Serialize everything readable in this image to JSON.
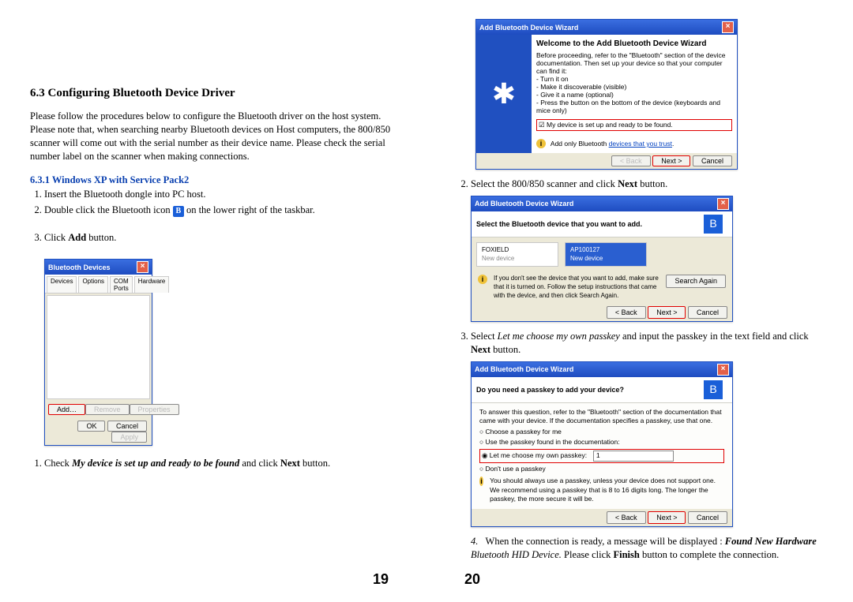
{
  "left": {
    "section_number": "6.3",
    "section_title": "Configuring Bluetooth Device Driver",
    "intro": "Please follow the procedures below to configure the Bluetooth driver on the host system. Please note that, when searching nearby Bluetooth devices on Host computers, the 800/850 scanner will come out with the serial number as their device name. Please check the serial number label on the scanner when making connections.",
    "sub_number": "6.3.1",
    "sub_title": "Windows XP with Service Pack2",
    "step1": "Insert the Bluetooth dongle into PC host.",
    "step2_pre": "Double click the Bluetooth icon",
    "step2_post": " on the lower right of the taskbar.",
    "step3_pre": "Click ",
    "step3_bold": "Add",
    "step3_post": " button.",
    "bottom_step_pre": "Check ",
    "bottom_step_bolditalic": "My device is set up and ready to be found",
    "bottom_step_mid": " and click ",
    "bottom_step_bold": "Next",
    "bottom_step_post": " button.",
    "dlg1": {
      "title": "Bluetooth Devices",
      "tabs": {
        "a": "Devices",
        "b": "Options",
        "c": "COM Ports",
        "d": "Hardware"
      },
      "add": "Add…",
      "remove": "Remove",
      "properties": "Properties",
      "ok": "OK",
      "cancel": "Cancel",
      "apply": "Apply"
    },
    "page_num": "19"
  },
  "right": {
    "dlg_welcome": {
      "title": "Add Bluetooth Device Wizard",
      "heading": "Welcome to the Add Bluetooth Device Wizard",
      "body1": "Before proceeding, refer to the \"Bluetooth\" section of the device documentation. Then set up your device so that your computer can find it:",
      "li1": "- Turn it on",
      "li2": "- Make it discoverable (visible)",
      "li3": "- Give it a name (optional)",
      "li4": "- Press the button on the bottom of the device (keyboards and mice only)",
      "check": "My device is set up and ready to be found.",
      "hint_pre": "Add only Bluetooth ",
      "hint_link": "devices that you trust",
      "back": "< Back",
      "next": "Next >",
      "cancel": "Cancel"
    },
    "step2_pre": "Select the 800/850 scanner and click ",
    "step2_bold": "Next",
    "step2_post": " button.",
    "dlg_select": {
      "title": "Add Bluetooth Device Wizard",
      "subtitle": "Select the Bluetooth device that you want to add.",
      "dev1_name": "FOXIELD",
      "dev1_type": "New device",
      "dev2_name": "AP100127",
      "dev2_type": "New device",
      "tip": "If you don't see the device that you want to add, make sure that it is turned on. Follow the setup instructions that came with the device, and then click Search Again.",
      "search": "Search Again",
      "back": "< Back",
      "next": "Next >",
      "cancel": "Cancel"
    },
    "step3_pre": "Select ",
    "step3_italic": "Let me choose my own passkey",
    "step3_mid": " and input the passkey in the text field and click ",
    "step3_bold": "Next",
    "step3_post": " button.",
    "dlg_passkey": {
      "title": "Add Bluetooth Device Wizard",
      "subtitle": "Do you need a passkey to add your device?",
      "body": "To answer this question, refer to the \"Bluetooth\" section of the documentation that came with your device. If the documentation specifies a passkey, use that one.",
      "r1": "Choose a passkey for me",
      "r2": "Use the passkey found in the documentation:",
      "r3": "Let me choose my own passkey:",
      "r4": "Don't use a passkey",
      "note": "You should always use a passkey, unless your device does not support one. We recommend using a passkey that is 8 to 16 digits long. The longer the passkey, the more secure it will be.",
      "back": "< Back",
      "next": "Next >",
      "cancel": "Cancel"
    },
    "step4_pre": "When the connection is ready, a message will be displayed : ",
    "step4_b1": "Found New Hardware",
    "step4_i": " Bluetooth HID Device.",
    "step4_mid": " Please click ",
    "step4_b2": "Finish",
    "step4_post": " button to complete the connection.",
    "page_num": "20"
  }
}
